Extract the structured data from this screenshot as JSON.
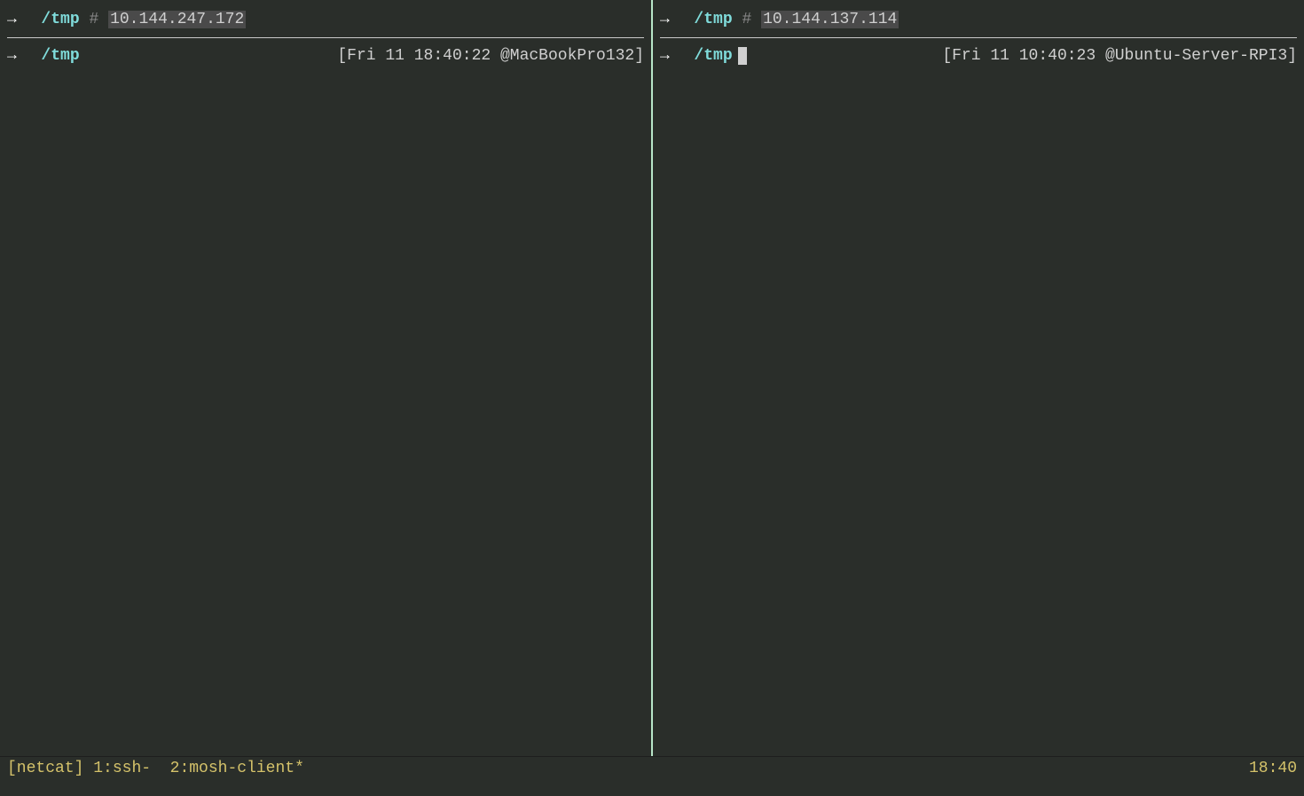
{
  "panes": {
    "left": {
      "top": {
        "arrow": "→",
        "cwd": "/tmp",
        "hash": "#",
        "ip": "10.144.247.172"
      },
      "bottom": {
        "arrow": "→",
        "cwd": "/tmp",
        "timestamp": "[Fri 11 18:40:22 @MacBookPro132]"
      }
    },
    "right": {
      "top": {
        "arrow": "→",
        "cwd": "/tmp",
        "hash": "#",
        "ip": "10.144.137.114"
      },
      "bottom": {
        "arrow": "→",
        "cwd": "/tmp",
        "timestamp": "[Fri 11 10:40:23 @Ubuntu-Server-RPI3]"
      }
    }
  },
  "statusbar": {
    "session": "[netcat]",
    "window1": "1:ssh-",
    "window2": "2:mosh-client*",
    "clock": "18:40"
  }
}
